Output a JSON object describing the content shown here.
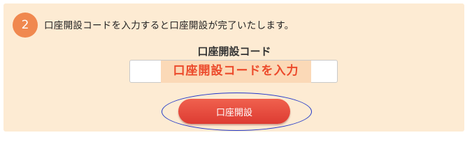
{
  "step": {
    "number": "2",
    "instruction": "口座開設コードを入力すると口座開設が完了いたします。"
  },
  "code_field": {
    "label": "口座開設コード",
    "value": "",
    "hint": "口座開設コードを入力"
  },
  "submit": {
    "label": "口座開設"
  },
  "colors": {
    "panel_bg": "#fdebd3",
    "step_circle": "#f0884f",
    "button": "#e8473a",
    "hint_text": "#ec4a2b",
    "highlight_oval": "#2138c9"
  }
}
